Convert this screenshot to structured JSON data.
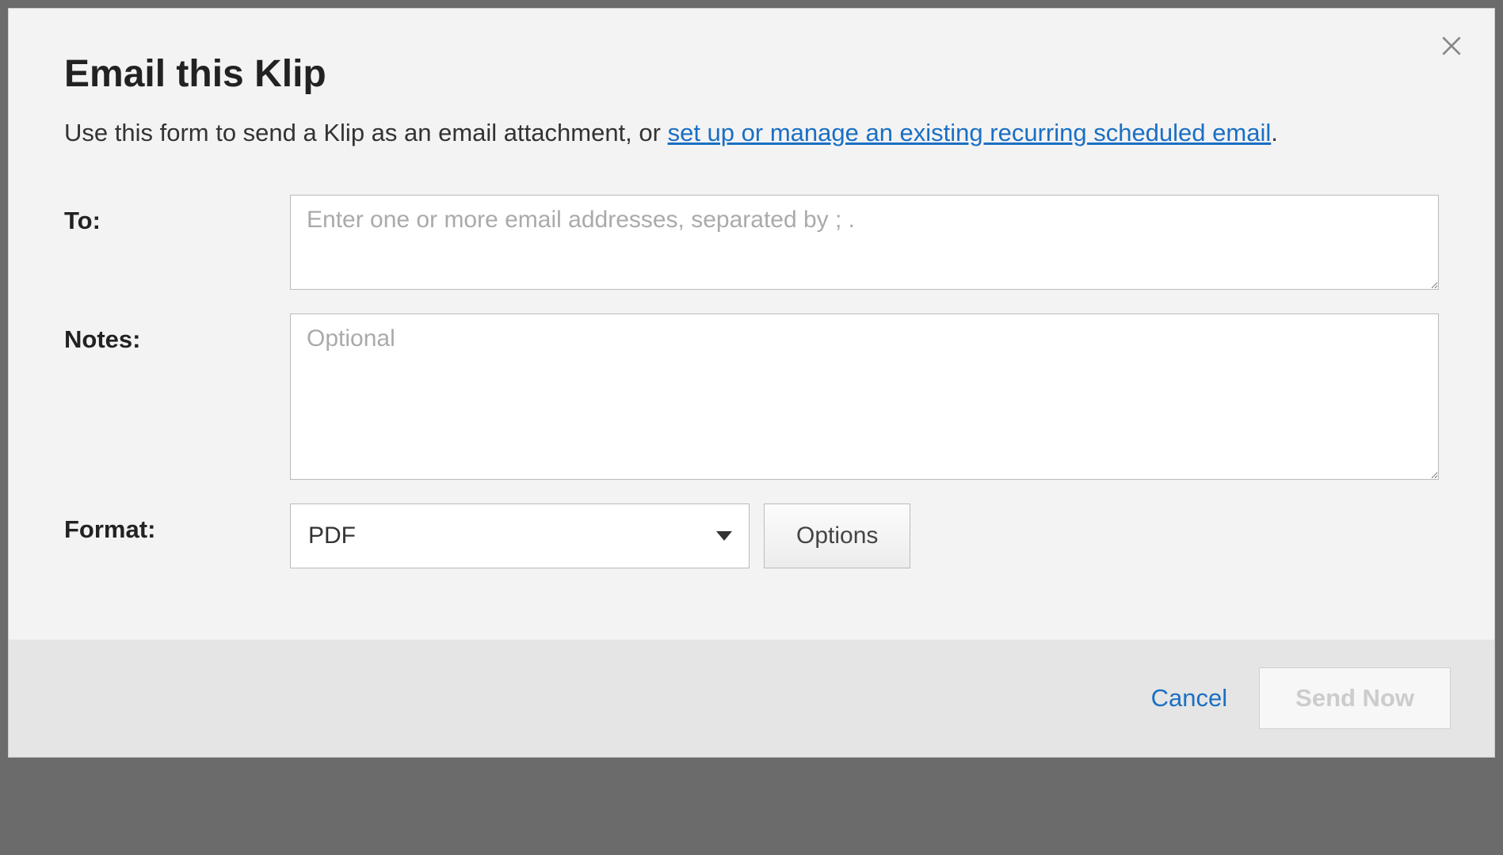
{
  "modal": {
    "title": "Email this Klip",
    "description_prefix": "Use this form to send a Klip as an email attachment, or ",
    "description_link": "set up or manage an existing recurring scheduled email",
    "description_suffix": "."
  },
  "form": {
    "to": {
      "label": "To:",
      "placeholder": "Enter one or more email addresses, separated by ; .",
      "value": ""
    },
    "notes": {
      "label": "Notes:",
      "placeholder": "Optional",
      "value": ""
    },
    "format": {
      "label": "Format:",
      "selected": "PDF",
      "options_button": "Options"
    }
  },
  "footer": {
    "cancel": "Cancel",
    "send": "Send Now"
  }
}
